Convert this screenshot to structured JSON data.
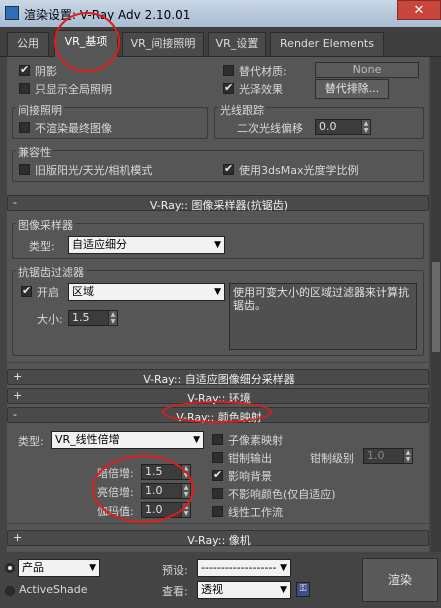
{
  "window": {
    "title": "渲染设置: V-Ray Adv 2.10.01",
    "close": "✕"
  },
  "tabs": [
    "公用",
    "VR_基项",
    "VR_间接照明",
    "VR_设置",
    "Render Elements"
  ],
  "top_options": {
    "shadows": "阴影",
    "show_gi_only": "只显示全局照明",
    "override_mtl": "替代材质:",
    "override_mtl_value": "None",
    "glossy": "光泽效果",
    "override_exclude": "替代排除..."
  },
  "indirect": {
    "title": "间接照明",
    "dont_render_final": "不渲染最终图像"
  },
  "raytrace": {
    "title": "光线跟踪",
    "secondary_bias": "二次光线偏移",
    "secondary_bias_value": "0.0"
  },
  "compat": {
    "title": "兼容性",
    "legacy_sun": "旧版阳光/天光/相机模式",
    "use_3dsmax_photometric": "使用3dsMax光度学比例"
  },
  "rollout_sampler": {
    "sign": "-",
    "title": "V-Ray:: 图像采样器(抗锯齿)"
  },
  "image_sampler": {
    "group": "图像采样器",
    "type_label": "类型:",
    "type_value": "自适应细分",
    "aa_group": "抗锯齿过滤器",
    "on_label": "开启",
    "filter_value": "区域",
    "filter_desc": "使用可变大小的区域过滤器来计算抗锯齿。",
    "size_label": "大小:",
    "size_value": "1.5"
  },
  "rollout_adaptive": {
    "sign": "+",
    "title": "V-Ray:: 自适应图像细分采样器"
  },
  "rollout_env": {
    "sign": "+",
    "title": "V-Ray:: 环境"
  },
  "rollout_color": {
    "sign": "-",
    "title": "V-Ray:: 颜色映射"
  },
  "color_mapping": {
    "type_label": "类型:",
    "type_value": "VR_线性倍增",
    "dark_mult_label": "暗倍增:",
    "dark_mult": "1.5",
    "bright_mult_label": "亮倍增:",
    "bright_mult": "1.0",
    "gamma_label": "伽玛值:",
    "gamma": "1.0",
    "subpixel": "子像素映射",
    "clamp": "钳制输出",
    "clamp_level_label": "钳制级别",
    "clamp_level": "1.0",
    "affect_bg": "影响背景",
    "dont_affect": "不影响颜色(仅自适应)",
    "linear_workflow": "线性工作流"
  },
  "rollout_camera": {
    "sign": "+",
    "title": "V-Ray:: 像机"
  },
  "bottom": {
    "product": "产品",
    "activeshade": "ActiveShade",
    "preset_label": "预设:",
    "preset_value": "-------------------",
    "view_label": "查看:",
    "view_value": "透视",
    "render": "渲染"
  }
}
